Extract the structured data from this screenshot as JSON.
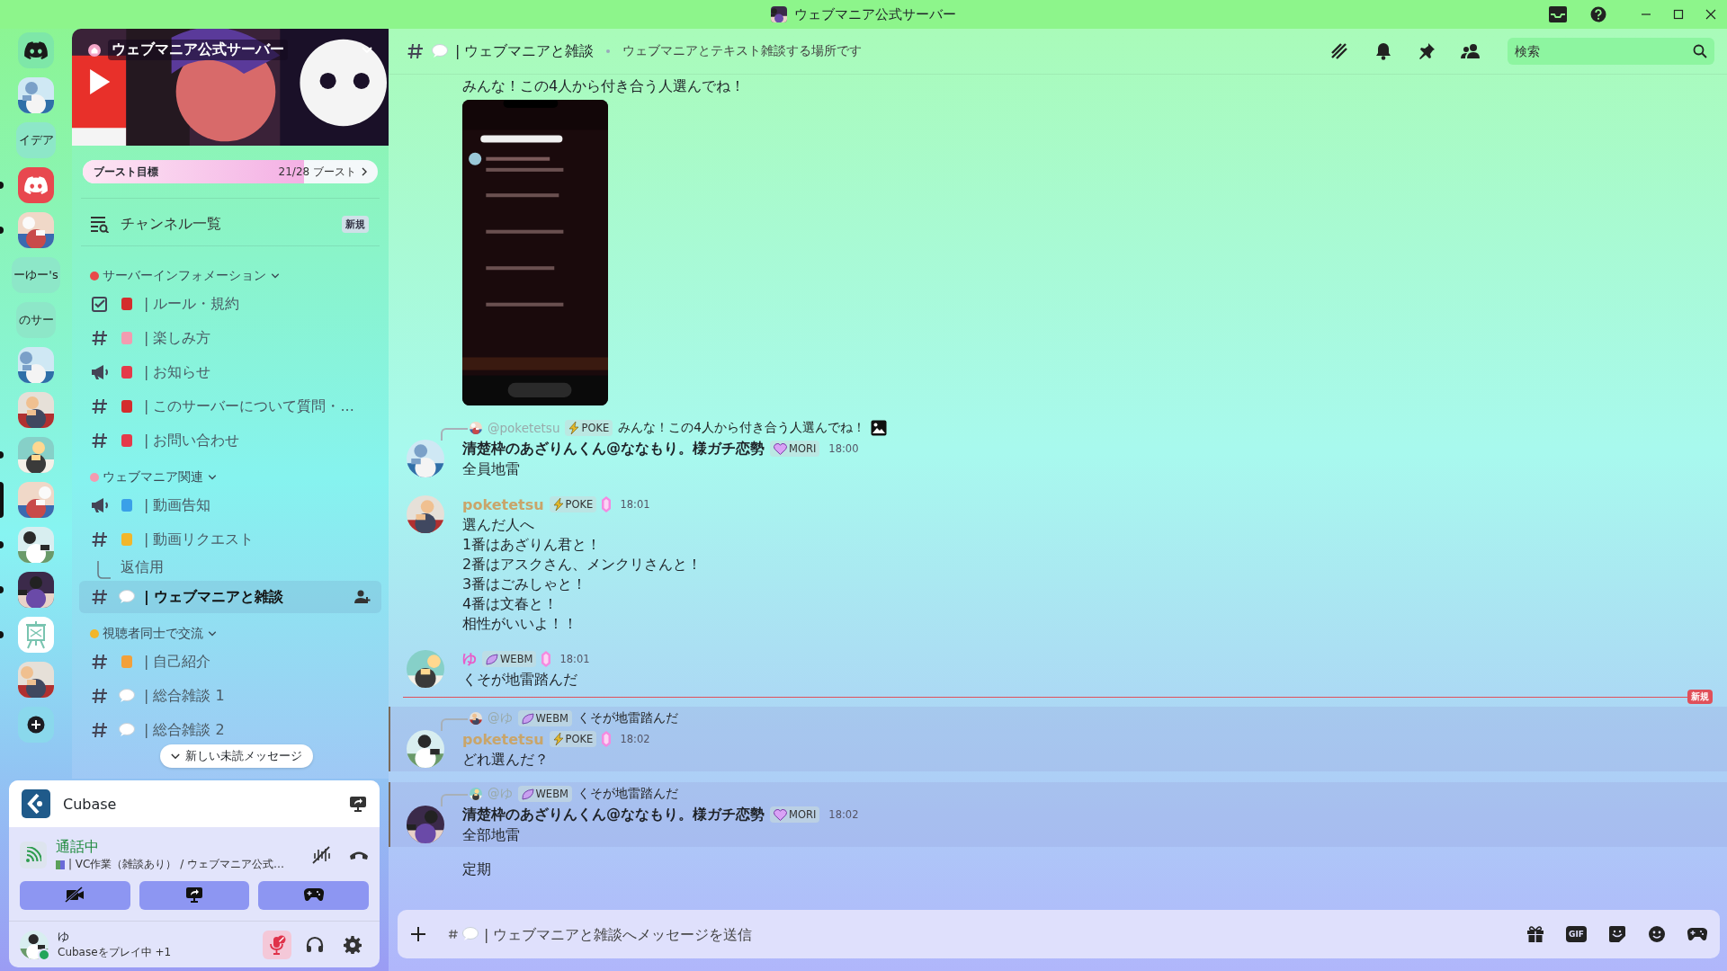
{
  "window": {
    "title": "ウェブマニア公式サーバー"
  },
  "servers": [
    {
      "kind": "logo",
      "unread": false,
      "selected": false
    },
    {
      "kind": "picture",
      "unread": false,
      "selected": false
    },
    {
      "kind": "text",
      "label": "イデア",
      "unread": false,
      "selected": false
    },
    {
      "kind": "logo_red",
      "unread": true,
      "selected": false
    },
    {
      "kind": "picture",
      "unread": true,
      "selected": false
    },
    {
      "kind": "text",
      "label": "ーゆー's",
      "unread": false,
      "selected": false
    },
    {
      "kind": "text",
      "label": "のサー",
      "unread": false,
      "selected": false
    },
    {
      "kind": "picture",
      "unread": false,
      "selected": false
    },
    {
      "kind": "picture",
      "unread": false,
      "selected": false
    },
    {
      "kind": "picture",
      "unread": true,
      "selected": false
    },
    {
      "kind": "picture",
      "unread": false,
      "selected": true
    },
    {
      "kind": "picture",
      "unread": true,
      "selected": false
    },
    {
      "kind": "picture",
      "unread": true,
      "selected": false
    },
    {
      "kind": "easel",
      "unread": true,
      "selected": false
    },
    {
      "kind": "picture",
      "unread": false,
      "selected": false
    },
    {
      "kind": "add",
      "unread": false,
      "selected": false
    }
  ],
  "server": {
    "name": "ウェブマニア公式サーバー",
    "boost": {
      "label": "ブースト目標",
      "count": "21/28 ブースト",
      "level": 0.75
    },
    "channel_browser": {
      "label": "チャンネル一覧",
      "badge": "新規"
    }
  },
  "categories": [
    {
      "name": "サーバーインフォメーション",
      "channels": [
        {
          "kind": "rules",
          "name": "| ルール・規約",
          "selected": false
        },
        {
          "kind": "text",
          "name": "| 楽しみ方",
          "selected": false
        },
        {
          "kind": "announcement",
          "name": "| お知らせ",
          "selected": false
        },
        {
          "kind": "text",
          "name": "| このサーバーについて質問・...",
          "selected": false
        },
        {
          "kind": "text",
          "name": "| お問い合わせ",
          "selected": false
        }
      ]
    },
    {
      "name": "ウェブマニア関連",
      "channels": [
        {
          "kind": "announcement",
          "name": "| 動画告知",
          "selected": false
        },
        {
          "kind": "text",
          "name": "| 動画リクエスト",
          "selected": false
        },
        {
          "kind": "thread",
          "name": "返信用",
          "selected": false
        },
        {
          "kind": "text",
          "name": "| ウェブマニアと雑談",
          "selected": true
        }
      ]
    },
    {
      "name": "視聴者同士で交流",
      "channels": [
        {
          "kind": "text",
          "name": "| 自己紹介",
          "selected": false
        },
        {
          "kind": "text",
          "name": "| 総合雑談 1",
          "selected": false
        },
        {
          "kind": "text",
          "name": "| 総合雑談 2",
          "selected": false
        }
      ]
    }
  ],
  "unread_pill": "新しい未読メッセージ",
  "activity": {
    "name": "Cubase"
  },
  "voice": {
    "status": "通話中",
    "channel": "| VC作業（雑談あり） / ウェブマニア公式…"
  },
  "user": {
    "name": "ゆ",
    "status": "Cubaseをプレイ中 +1",
    "mic_muted": true
  },
  "channel_header": {
    "name": "| ウェブマニアと雑談",
    "topic": "ウェブマニアとテキスト雑談する場所です",
    "search_placeholder": "検索"
  },
  "messages": [
    {
      "kind": "continuation",
      "lines": [
        "みんな！この4人から付き合う人選んでね！"
      ],
      "attachment": {
        "kind": "picture"
      },
      "mentioned": false
    },
    {
      "kind": "message",
      "reply": {
        "author": "@poketetsu",
        "tag": {
          "label": "POKE",
          "kind": "bolt"
        },
        "text": "みんな！この4人から付き合う人選んでね！",
        "has_image": true
      },
      "author": "清楚枠のあざりんくん@ななもり。様ガチ恋勢",
      "color": "#1f2328",
      "tag": {
        "label": "MORI",
        "kind": "heart"
      },
      "gem": false,
      "time": "18:00",
      "lines": [
        "全員地雷"
      ],
      "mentioned": false
    },
    {
      "kind": "message",
      "author": "poketetsu",
      "color": "#c9a56a",
      "tag": {
        "label": "POKE",
        "kind": "bolt"
      },
      "gem": true,
      "time": "18:01",
      "lines": [
        "選んだ人へ",
        "1番はあざりん君と！",
        "2番はアスクさん、メンクリさんと！",
        "3番はごみしゃと！",
        "4番は文春と！",
        "相性がいいよ！！"
      ],
      "mentioned": false
    },
    {
      "kind": "message",
      "author": "ゆ",
      "color": "#e85cc8",
      "tag": {
        "label": "WEBM",
        "kind": "leaf"
      },
      "gem": true,
      "time": "18:01",
      "lines": [
        "くそが地雷踏んだ"
      ],
      "mentioned": false
    },
    {
      "kind": "divider",
      "label": "新規"
    },
    {
      "kind": "message",
      "reply": {
        "author": "@ゆ",
        "tag": {
          "label": "WEBM",
          "kind": "leaf"
        },
        "text": "くそが地雷踏んだ",
        "has_image": false
      },
      "author": "poketetsu",
      "color": "#c9a56a",
      "tag": {
        "label": "POKE",
        "kind": "bolt"
      },
      "gem": true,
      "time": "18:02",
      "lines": [
        "どれ選んだ？"
      ],
      "mentioned": true
    },
    {
      "kind": "message",
      "reply": {
        "author": "@ゆ",
        "tag": {
          "label": "WEBM",
          "kind": "leaf"
        },
        "text": "くそが地雷踏んだ",
        "has_image": false
      },
      "author": "清楚枠のあざりんくん@ななもり。様ガチ恋勢",
      "color": "#1f2328",
      "tag": {
        "label": "MORI",
        "kind": "heart"
      },
      "gem": false,
      "time": "18:02",
      "lines": [
        "全部地雷"
      ],
      "mentioned": true
    },
    {
      "kind": "continuation",
      "lines": [
        "定期"
      ],
      "mentioned": false
    }
  ],
  "composer": {
    "placeholder": "| ウェブマニアと雑談へメッセージを送信",
    "gif_label": "GIF"
  }
}
